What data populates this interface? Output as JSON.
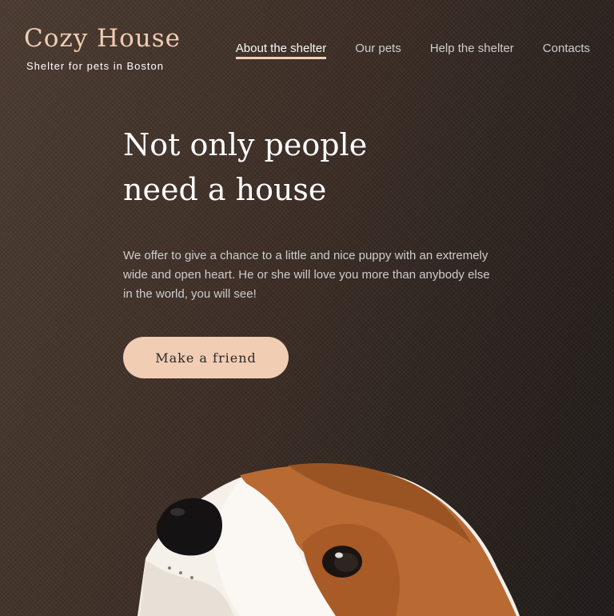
{
  "header": {
    "logo_title": "Cozy House",
    "logo_subtitle": "Shelter for pets in Boston",
    "nav": [
      {
        "label": "About the shelter",
        "active": true
      },
      {
        "label": "Our pets",
        "active": false
      },
      {
        "label": "Help the shelter",
        "active": false
      },
      {
        "label": "Contacts",
        "active": false
      }
    ]
  },
  "hero": {
    "headline_line1": "Not only people",
    "headline_line2": "need a house",
    "description": "We offer to give a chance to a little and nice puppy with an extremely wide and open heart. He or she will love you more than anybody else in the world, you will see!",
    "cta_label": "Make a friend",
    "image": "puppy-photo"
  },
  "colors": {
    "accent": "#f1cdb3",
    "background": "#3a2c24",
    "text_light": "#cdcdcd",
    "button_text": "#292929"
  }
}
